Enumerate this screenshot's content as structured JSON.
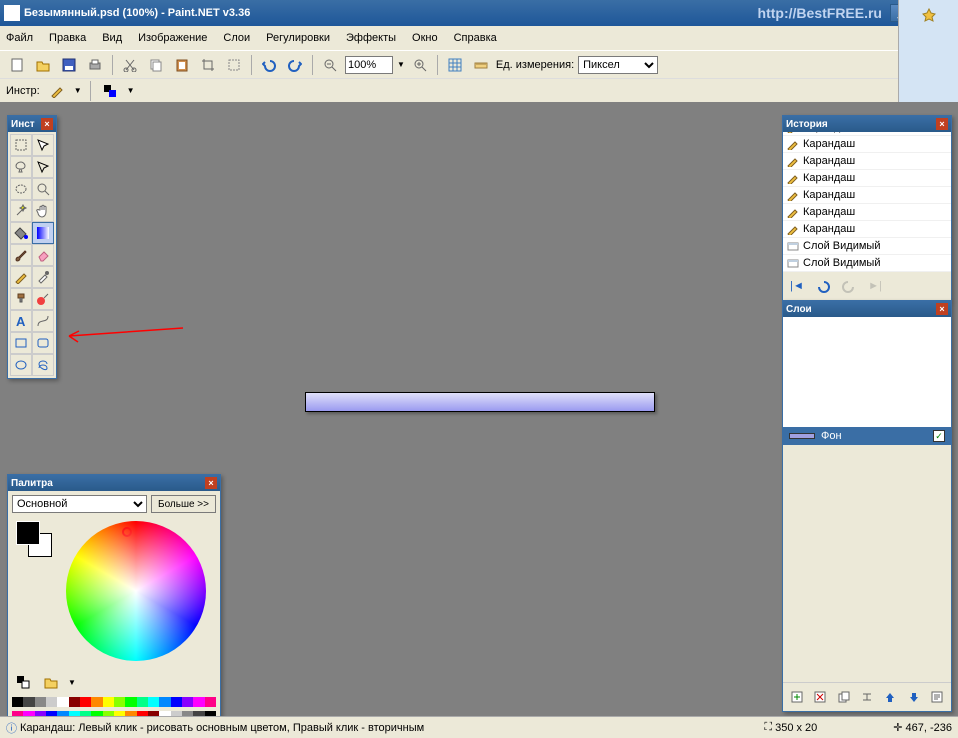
{
  "window": {
    "title": "Безымянный.psd (100%) - Paint.NET v3.36",
    "url": "http://BestFREE.ru"
  },
  "menu": [
    "Файл",
    "Правка",
    "Вид",
    "Изображение",
    "Слои",
    "Регулировки",
    "Эффекты",
    "Окно",
    "Справка"
  ],
  "toolbar": {
    "zoom": "100%",
    "units_label": "Ед. измерения:",
    "units_value": "Пиксел"
  },
  "subtoolbar": {
    "label": "Инстр:"
  },
  "tools_panel": {
    "title": "Инст"
  },
  "palette": {
    "title": "Палитра",
    "mode": "Основной",
    "more": "Больше >>"
  },
  "history": {
    "title": "История",
    "items": [
      {
        "icon": "pencil",
        "label": "Карандаш"
      },
      {
        "icon": "pencil",
        "label": "Карандаш"
      },
      {
        "icon": "pencil",
        "label": "Карандаш"
      },
      {
        "icon": "pencil",
        "label": "Карандаш"
      },
      {
        "icon": "pencil",
        "label": "Карандаш"
      },
      {
        "icon": "pencil",
        "label": "Карандаш"
      },
      {
        "icon": "pencil",
        "label": "Карандаш"
      },
      {
        "icon": "layer",
        "label": "Слой Видимый"
      },
      {
        "icon": "layer",
        "label": "Слой Видимый"
      }
    ]
  },
  "layers": {
    "title": "Слои",
    "background": "Фон"
  },
  "status": {
    "help": "Карандаш: Левый клик - рисовать основным цветом, Правый клик - вторичным",
    "canvas_size": "350 x 20",
    "cursor": "467, -236"
  },
  "swatches": [
    "#000",
    "#444",
    "#888",
    "#ccc",
    "#fff",
    "#800",
    "#f00",
    "#f80",
    "#ff0",
    "#8f0",
    "#0f0",
    "#0f8",
    "#0ff",
    "#08f",
    "#00f",
    "#80f",
    "#f0f",
    "#f08"
  ]
}
